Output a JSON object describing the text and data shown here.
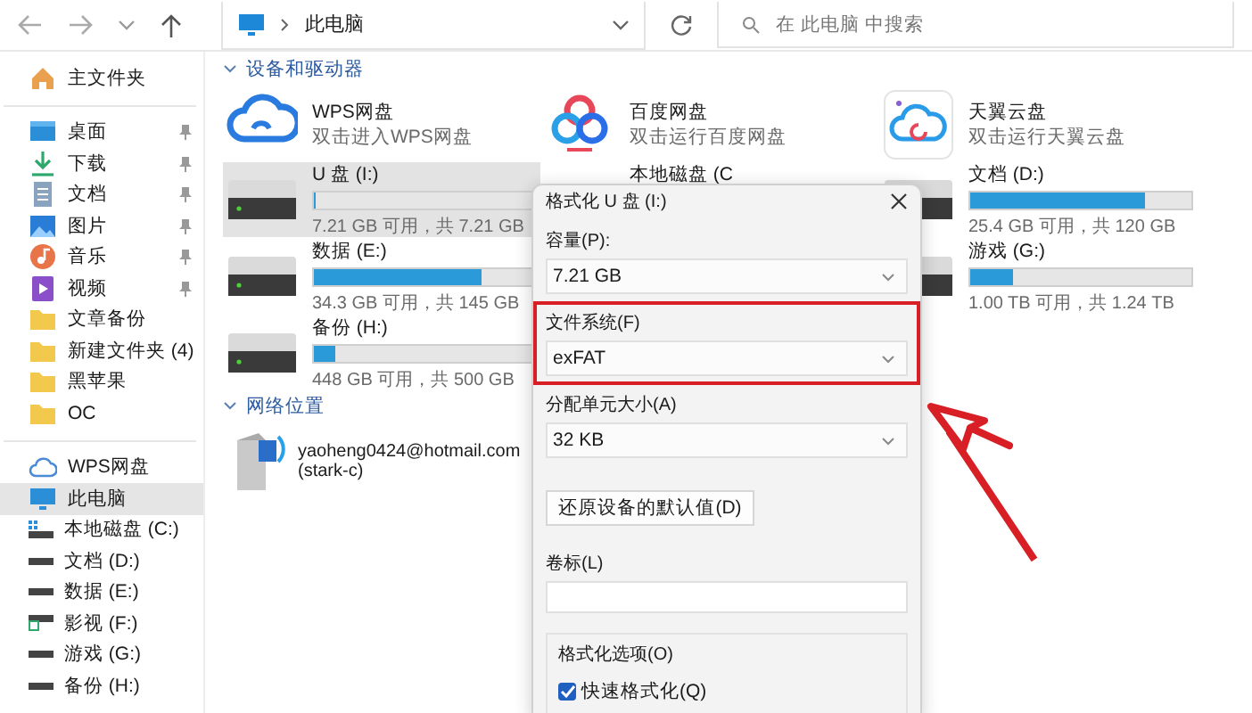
{
  "toolbar": {
    "address": "此电脑",
    "search": {
      "placeholder": "在 此电脑 中搜索"
    }
  },
  "sidebar": {
    "groups": [
      {
        "items": [
          {
            "label": "主文件夹",
            "kind": "home",
            "pinned": false,
            "selected": false
          }
        ]
      },
      {
        "items": [
          {
            "label": "桌面",
            "kind": "desktop",
            "pinned": true,
            "selected": false
          },
          {
            "label": "下载",
            "kind": "download",
            "pinned": true,
            "selected": false
          },
          {
            "label": "文档",
            "kind": "docs",
            "pinned": true,
            "selected": false
          },
          {
            "label": "图片",
            "kind": "pictures",
            "pinned": true,
            "selected": false
          },
          {
            "label": "音乐",
            "kind": "music",
            "pinned": true,
            "selected": false
          },
          {
            "label": "视频",
            "kind": "video",
            "pinned": true,
            "selected": false
          },
          {
            "label": "文章备份",
            "kind": "folder",
            "pinned": false,
            "selected": false
          },
          {
            "label": "新建文件夹 (4)",
            "kind": "folder",
            "pinned": false,
            "selected": false
          },
          {
            "label": "黑苹果",
            "kind": "folder",
            "pinned": false,
            "selected": false
          },
          {
            "label": "OC",
            "kind": "folder",
            "pinned": false,
            "selected": false
          }
        ]
      },
      {
        "items": [
          {
            "label": "WPS网盘",
            "kind": "cloud",
            "pinned": false,
            "selected": false
          },
          {
            "label": "此电脑",
            "kind": "pc",
            "pinned": false,
            "selected": true
          },
          {
            "label": "本地磁盘 (C:)",
            "kind": "system-drive",
            "pinned": false,
            "selected": false
          },
          {
            "label": "文档 (D:)",
            "kind": "drive",
            "pinned": false,
            "selected": false
          },
          {
            "label": "数据 (E:)",
            "kind": "drive",
            "pinned": false,
            "selected": false
          },
          {
            "label": "影视 (F:)",
            "kind": "media-drive",
            "pinned": false,
            "selected": false
          },
          {
            "label": "游戏 (G:)",
            "kind": "drive",
            "pinned": false,
            "selected": false
          },
          {
            "label": "备份 (H:)",
            "kind": "drive",
            "pinned": false,
            "selected": false
          }
        ]
      }
    ]
  },
  "devices": {
    "title": "设备和驱动器",
    "expanded": true,
    "columns": [
      [
        {
          "kind": "app",
          "name": "WPS网盘",
          "subtitle": "双击进入WPS网盘"
        },
        {
          "kind": "drive",
          "name": "U 盘 (I:)",
          "level": 0.005,
          "info": "7.21 GB 可用，共 7.21 GB",
          "selected": true
        },
        {
          "kind": "drive",
          "name": "数据 (E:)",
          "level": 0.76,
          "info": "34.3 GB 可用，共 145 GB",
          "selected": false
        },
        {
          "kind": "drive",
          "name": "备份 (H:)",
          "level": 0.1,
          "info": "448 GB 可用，共 500 GB",
          "selected": false
        }
      ],
      [
        {
          "kind": "app",
          "name": "百度网盘",
          "subtitle": "双击运行百度网盘"
        },
        {
          "kind": "partial",
          "name": "本地磁盘 (C"
        }
      ],
      [
        {
          "kind": "app",
          "name": "天翼云盘",
          "subtitle": "双击运行天翼云盘"
        },
        {
          "kind": "drive",
          "name": "文档 (D:)",
          "level": 0.79,
          "info": "25.4 GB 可用，共 120 GB",
          "selected": false
        },
        {
          "kind": "drive",
          "name": "游戏 (G:)",
          "level": 0.19,
          "info": "1.00 TB 可用，共 1.24 TB",
          "selected": false
        }
      ]
    ]
  },
  "network": {
    "title": "网络位置",
    "expanded": true,
    "items": [
      {
        "name": "yaoheng0424@hotmail.com",
        "subtitle": "(stark-c)"
      }
    ]
  },
  "dialog": {
    "title": "格式化 U 盘 (I:)",
    "fields": [
      {
        "kind": "select",
        "label": "容量(P):",
        "value": "7.21 GB",
        "highlighted": false
      },
      {
        "kind": "select",
        "label": "文件系统(F)",
        "value": "exFAT",
        "highlighted": true
      },
      {
        "kind": "select",
        "label": "分配单元大小(A)",
        "value": "32 KB",
        "highlighted": false
      },
      {
        "kind": "button",
        "label": "还原设备的默认值(D)",
        "highlighted": false
      },
      {
        "kind": "text",
        "label": "卷标(L)",
        "highlighted": false
      }
    ],
    "options": {
      "title": "格式化选项(O)",
      "checkboxes": [
        {
          "label": "快速格式化(Q)",
          "checked": true
        }
      ]
    }
  }
}
